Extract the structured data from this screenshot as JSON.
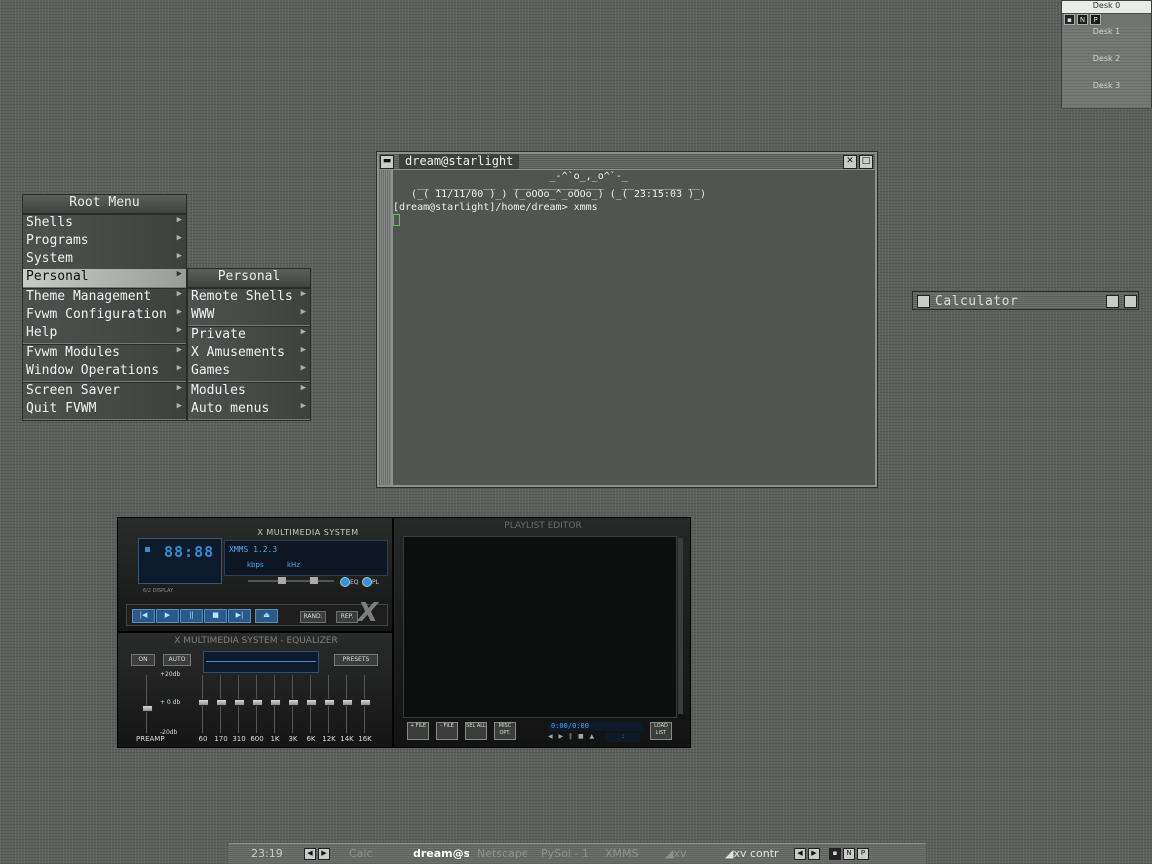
{
  "pager": {
    "desks": [
      "Desk 0",
      "Desk 1",
      "Desk 2",
      "Desk 3"
    ],
    "icons": [
      "N",
      "P"
    ]
  },
  "root_menu": {
    "title": "Root Menu",
    "groups": [
      [
        "Shells",
        "Programs",
        "System",
        "Personal"
      ],
      [
        "Theme Management",
        "Fvwm Configuration",
        "Help"
      ],
      [
        "Fvwm Modules",
        "Window Operations"
      ],
      [
        "Screen Saver",
        "Quit FVWM"
      ]
    ],
    "selected": "Personal"
  },
  "personal_menu": {
    "title": "Personal",
    "groups": [
      [
        "Remote Shells",
        "WWW"
      ],
      [
        "Private",
        "X Amusements",
        "Games"
      ],
      [
        "Modules",
        "Auto menus"
      ]
    ]
  },
  "terminal": {
    "title": "dream@starlight",
    "lines": [
      "                          _-^`o_,_o^`-_",
      "    __ _______ __   ___ _______ ___   __ _______ __",
      "   (_( 11/11/00 )_) (_oOOo_^_oOOo_) (_( 23:15:03 )_)",
      "[dream@starlight]/home/dream> xmms"
    ]
  },
  "calculator": {
    "title": "Calculator"
  },
  "xmms": {
    "title": "X MULTIMEDIA SYSTEM",
    "lcd_time": "88:88",
    "lcd_caption": "6/2 DISPLAY",
    "song": "XMMS 1.2.3",
    "kbps": "kbps",
    "khz": "kHz",
    "eq_label": "EQ",
    "pl_label": "PL",
    "controls": [
      "|◀",
      "▶",
      "||",
      "■",
      "▶|",
      "⏏"
    ],
    "shuffle": "RAND.",
    "repeat": "REP.",
    "logo": "X"
  },
  "equalizer": {
    "title": "X MULTIMEDIA SYSTEM - EQUALIZER",
    "on": "ON",
    "auto": "AUTO",
    "presets": "PRESETS",
    "db_top": "+20db",
    "db_mid": "+ 0 db",
    "db_bot": "-20db",
    "preamp": "PREAMP",
    "bands": [
      "60",
      "170",
      "310",
      "600",
      "1K",
      "3K",
      "6K",
      "12K",
      "14K",
      "16K"
    ]
  },
  "playlist": {
    "title": "PLAYLIST EDITOR",
    "buttons": [
      "+ FILE",
      "- FILE",
      "SEL ALL",
      "MISC OPT.",
      "LOAD LIST"
    ],
    "time": "0:00/0:00",
    "position": ":"
  },
  "taskbar": {
    "clock": "23:19",
    "tasks": [
      "Calc",
      "dream@s",
      "Netscape",
      "PySol - 1",
      "XMMS",
      "xv",
      "xv contr"
    ],
    "current": "dream@s",
    "icons": [
      "N",
      "P"
    ]
  }
}
